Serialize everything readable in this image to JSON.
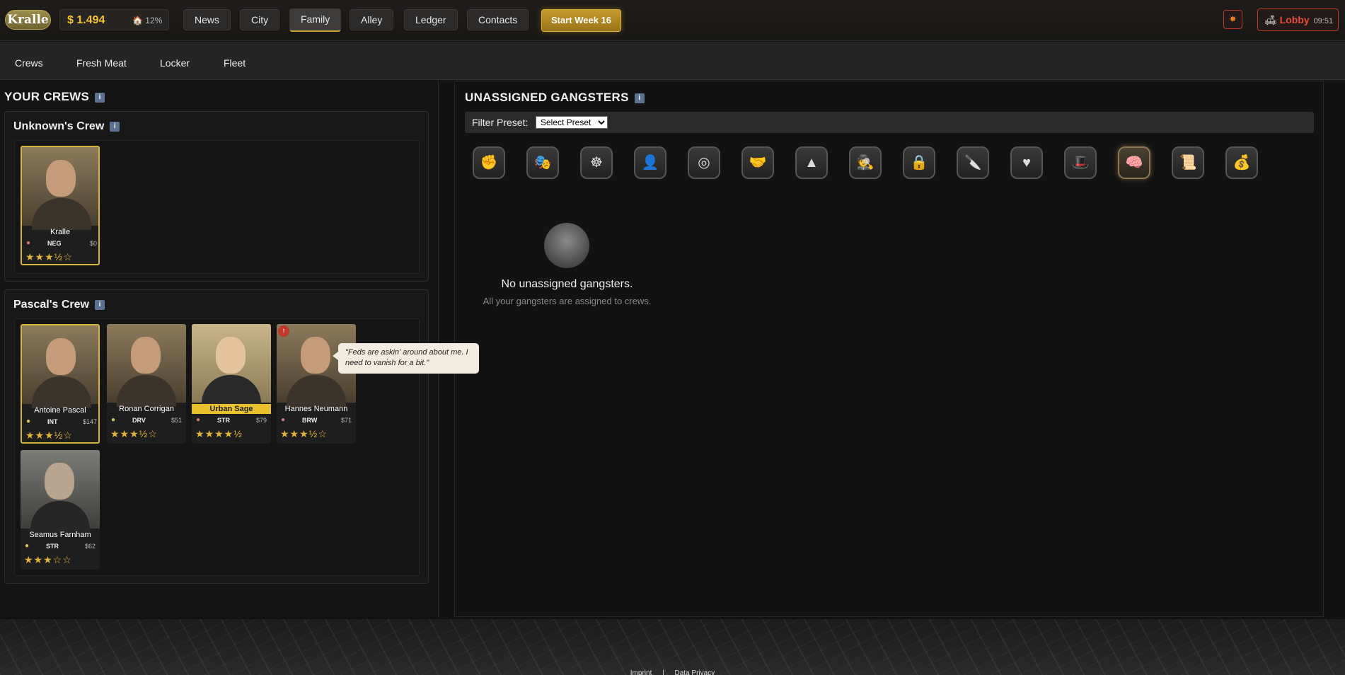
{
  "topbar": {
    "logo": "Kralle",
    "money": "$ 1.494",
    "heat": "🏠 12%",
    "nav": [
      "News",
      "City",
      "Family",
      "Alley",
      "Ledger",
      "Contacts"
    ],
    "active_nav": "Family",
    "start_week": "Start Week 16",
    "lobby": {
      "icon": "🛋",
      "label": "Lobby",
      "time": "09:51"
    }
  },
  "subnav": [
    "Crews",
    "Fresh Meat",
    "Locker",
    "Fleet"
  ],
  "left": {
    "title": "YOUR CREWS",
    "crews": [
      {
        "name": "Unknown's Crew",
        "members": [
          {
            "name": "Kralle",
            "trait": "NEG",
            "wage": "$0",
            "stars": "★★★½☆",
            "leader": true
          }
        ]
      },
      {
        "name": "Pascal's Crew",
        "members": [
          {
            "name": "Antoine Pascal",
            "trait": "INT",
            "wage": "$147",
            "stars": "★★★½☆",
            "leader": true
          },
          {
            "name": "Ronan Corrigan",
            "trait": "DRV",
            "wage": "$51",
            "stars": "★★★½☆"
          },
          {
            "name": "Urban Sage",
            "trait": "STR",
            "wage": "$79",
            "stars": "★★★★½"
          },
          {
            "name": "Hannes Neumann",
            "trait": "BRW",
            "wage": "$71",
            "stars": "★★★½☆"
          },
          {
            "name": "Seamus Farnham",
            "trait": "STR",
            "wage": "$62",
            "stars": "★★★☆☆"
          }
        ]
      }
    ],
    "speech": "\"Feds are askin' around about me. I need to vanish for a bit.\""
  },
  "right": {
    "title": "UNASSIGNED GANGSTERS",
    "filter_label": "Filter Preset:",
    "filter_value": "Select Preset",
    "roles": [
      "✊",
      "🎭",
      "☸",
      "👤",
      "◎",
      "🤝",
      "▲",
      "🕵",
      "🔒",
      "🔪",
      "♥",
      "🎩",
      "🧠",
      "📜",
      "💰"
    ],
    "empty_title": "No unassigned gangsters.",
    "empty_sub": "All your gangsters are assigned to crews."
  },
  "footer": {
    "imprint": "Imprint",
    "sep": "|",
    "privacy": "Data Privacy"
  },
  "colors": {
    "accent": "#d6b43a",
    "money": "#f1c232",
    "alert": "#c0392b"
  }
}
